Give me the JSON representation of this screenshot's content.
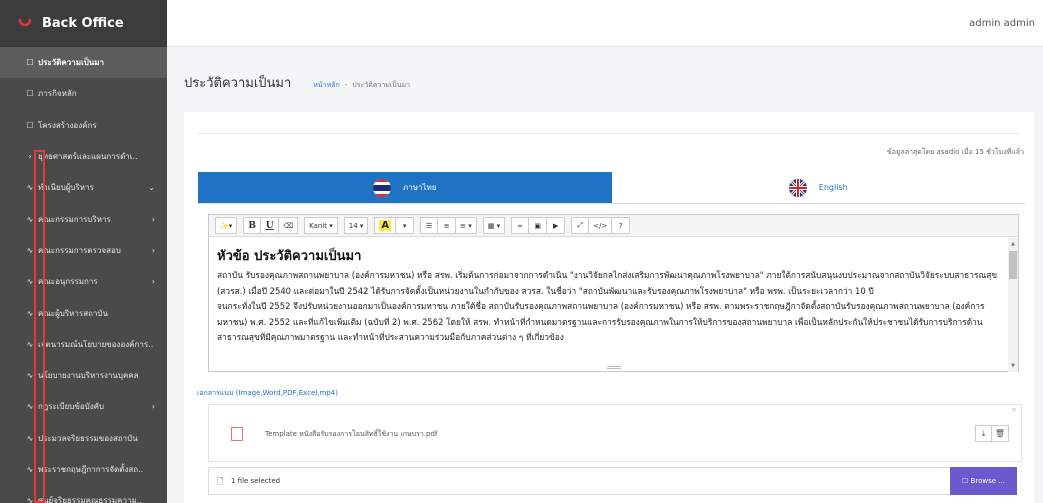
{
  "brand": {
    "title": "Back Office",
    "color": "#e53935"
  },
  "user": {
    "name": "admin admin"
  },
  "sidebar": {
    "items": [
      {
        "icon": "☐",
        "label": "ประวัติความเป็นมา",
        "active": true,
        "chevron": ""
      },
      {
        "icon": "☐",
        "label": "ภารกิจหลัก",
        "active": false,
        "chevron": ""
      },
      {
        "icon": "☐",
        "label": "โครงสร้างองค์กร",
        "active": false,
        "chevron": ""
      },
      {
        "icon": "›",
        "label": "ยุทธศาสตร์และแผนการดำเ..",
        "active": false,
        "chevron": ""
      },
      {
        "icon": "∿",
        "label": "ทำเนียบผู้บริหาร",
        "active": false,
        "chevron": "⌄"
      },
      {
        "icon": "∿",
        "label": "คณะกรรมการบริหาร",
        "active": false,
        "chevron": "›"
      },
      {
        "icon": "∿",
        "label": "คณะกรรมการตรวจสอบ",
        "active": false,
        "chevron": "›"
      },
      {
        "icon": "∿",
        "label": "คณะอนุกรรมการ",
        "active": false,
        "chevron": "›"
      },
      {
        "icon": "∿",
        "label": "คณะผู้บริหารสถาบัน",
        "active": false,
        "chevron": ""
      },
      {
        "icon": "∿",
        "label": "เจตนารมณ์นโยบายขององค์การ..",
        "active": false,
        "chevron": ""
      },
      {
        "icon": "∿",
        "label": "นโยบายงานบริหารงานบุคคล",
        "active": false,
        "chevron": ""
      },
      {
        "icon": "∿",
        "label": "กฎระเบียบข้อบังคับ",
        "active": false,
        "chevron": "›"
      },
      {
        "icon": "∿",
        "label": "ประมวลจริยธรรมของสถาบัน",
        "active": false,
        "chevron": ""
      },
      {
        "icon": "∿",
        "label": "พระราชกฤษฎีกาการจัดตั้งสถ..",
        "active": false,
        "chevron": ""
      },
      {
        "icon": "∿",
        "label": "ศูนย์จริยธรรมคุณธรรมความ..",
        "active": false,
        "chevron": ""
      }
    ]
  },
  "page": {
    "title": "ประวัติความเป็นมา",
    "breadcrumb": {
      "home": "หน้าหลัก",
      "separator": "-",
      "current": "ประวัติความเป็นมา"
    },
    "updated_note": "ข้อมูลล่าสุดโดย asadio เมื่อ 15 ชั่วโมงที่แล้ว"
  },
  "tabs": [
    {
      "label": "ภาษาไทย",
      "active": true
    },
    {
      "label": "English",
      "active": false
    }
  ],
  "toolbar": {
    "magic": "✨▾",
    "bold": "B",
    "underline": "U",
    "eraser": "⌫",
    "font": "Kanit ▾",
    "size": "14 ▾",
    "color": "A",
    "color_caret": "▾",
    "ul": "☰",
    "ol": "≡",
    "align": "≡ ▾",
    "table": "▦ ▾",
    "link": "∞",
    "picture": "▣",
    "video": "▶",
    "fullscreen": "⤢",
    "code": "</>",
    "help": "?"
  },
  "editor": {
    "heading": "หัวข้อ ประวัติความเป็นมา",
    "paragraphs": [
      "    สถาบัน รับรองคุณภาพสถานพยาบาล (องค์การมหาชน) หรือ สรพ. เริ่มต้นการก่อมาจากการดำเนิน \"งานวิจัยกลไกส่งเสริมการพัฒนาคุณภาพโรงพยาบาล\" ภายใต้การสนับสนุนงบประมาณจากสถาบันวิจัยระบบสาธารณสุข (สวรส.) เมื่อปี 2540 และต่อมาในปี 2542 ได้รับการจัดตั้งเป็นหน่วยงานในกำกับของ สวรส. ในชื่อว่า \"สถาบันพัฒนาและรับรองคุณภาพโรงพยาบาล\" หรือ พรพ. เป็นระยะเวลากว่า 10 ปี",
      "    จนกระทั่งในปี 2552 จึงปรับหน่วยงานออกมาเป็นองค์การมหาชน ภายใต้ชื่อ สถาบันรับรองคุณภาพสถานพยาบาล (องค์การมหาชน) หรือ สรพ. ตามพระราชกฤษฎีกาจัดตั้งสถาบันรับรองคุณภาพสถานพยาบาล (องค์การมหาชน) พ.ศ. 2552 และที่แก้ไขเพิ่มเติม (ฉบับที่ 2) พ.ศ. 2562 โดยให้ สรพ. ทำหน้าที่กำหนดมาตรฐานและการรับรองคุณภาพในการให้บริการของสถานพยาบาล เพื่อเป็นหลักประกันให้ประชาชนได้รับการบริการด้านสาธารณสุขที่มีคุณภาพมาตรฐาน และทำหน้าที่ประสานความร่วมมือกับภาคส่วนต่าง ๆ ที่เกี่ยวข้อง"
    ]
  },
  "attachments": {
    "label": "เอกสารแนบ (Image,Word,PDF,Excel,mp4)",
    "file_name": "Template หนังสือรับรองการโอนสิทธิ์ใช้งาน เกษบรา.pdf",
    "download_icon": "⤓",
    "delete_icon": "🗑",
    "close_icon": "×",
    "selected_text": "1 file selected",
    "browse_label": "☐ Browse ..."
  }
}
